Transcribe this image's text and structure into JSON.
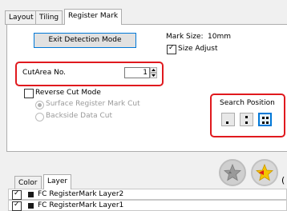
{
  "tabs": [
    {
      "label": "Layout"
    },
    {
      "label": "Tiling"
    },
    {
      "label": "Register Mark"
    }
  ],
  "register_mark": {
    "exit_detection_label": "Exit Detection Mode",
    "mark_size_label": "Mark Size:",
    "mark_size_value": "10mm",
    "size_adjust_label": "Size Adjust",
    "size_adjust_checked": true,
    "cutarea_label": "CutArea No.",
    "cutarea_value": "1",
    "reverse_cut_label": "Reverse Cut Mode",
    "reverse_cut_checked": false,
    "surface_cut_label": "Surface Register Mark Cut",
    "backside_cut_label": "Backside Data Cut",
    "search_position_label": "Search Position",
    "search_position_options": [
      "position-1",
      "position-2",
      "position-4"
    ],
    "search_position_selected": "position-4"
  },
  "bottom": {
    "tabs": [
      {
        "label": "Color"
      },
      {
        "label": "Layer"
      }
    ],
    "active_tab": "Layer",
    "icons": [
      "star-grey-icon",
      "star-yellow-icon"
    ],
    "layers": [
      {
        "name": "FC RegisterMark Layer2",
        "checked": true
      },
      {
        "name": "FC RegisterMark Layer1",
        "checked": true
      }
    ]
  },
  "colors": {
    "highlight": "#e0191e",
    "accent": "#0078d7"
  }
}
